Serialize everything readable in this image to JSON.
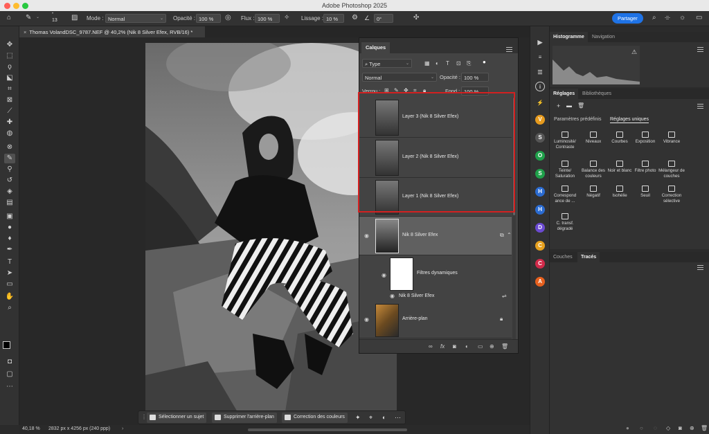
{
  "app": {
    "title": "Adobe Photoshop 2025"
  },
  "options_bar": {
    "brush_size": "13",
    "mode_label": "Mode :",
    "mode_value": "Normal",
    "opacity_label": "Opacité :",
    "opacity_value": "100 %",
    "flow_label": "Flux :",
    "flow_value": "100 %",
    "smoothing_label": "Lissage :",
    "smoothing_value": "10 %",
    "angle_value": "0°",
    "share_label": "Partager"
  },
  "document": {
    "tab_title": "Thomas VolandDSC_9787.NEF @ 40,2% (Nik 8 Silver Efex, RVB/16) *"
  },
  "layers_panel": {
    "tab_label": "Calques",
    "filter_type": "Type",
    "blend_mode": "Normal",
    "opacity_label": "Opacité :",
    "opacity_value": "100 %",
    "lock_label": "Verrou :",
    "fill_label": "Fond :",
    "fill_value": "100 %",
    "layers": [
      {
        "name": "Layer 3 (Nik 8 Silver Efex)",
        "visible": false
      },
      {
        "name": "Layer 2 (Nik 8 Silver Efex)",
        "visible": false
      },
      {
        "name": "Layer 1 (Nik 8 Silver Efex)",
        "visible": false
      },
      {
        "name": "Nik 8 Silver Efex",
        "visible": true,
        "selected": true
      },
      {
        "name": "Filtres dynamiques",
        "visible": true
      },
      {
        "name": "Nik 8 Silver Efex",
        "visible": true
      },
      {
        "name": "Arrière-plan",
        "visible": true,
        "locked": true
      }
    ]
  },
  "context_bar": {
    "select_subject": "Sélectionner un sujet",
    "remove_background": "Supprimer l'arrière-plan",
    "color_correction": "Correction des couleurs"
  },
  "status_bar": {
    "zoom": "40,18 %",
    "dimensions": "2832 px x 4256 px (240 ppp)"
  },
  "histogram_panel": {
    "tabs": [
      "Histogramme",
      "Navigation"
    ]
  },
  "adjustments_panel": {
    "tabs": [
      "Réglages",
      "Bibliothèques"
    ],
    "subtabs": [
      "Paramètres prédéfinis",
      "Réglages uniques"
    ],
    "items": [
      "Luminosité/ Contraste",
      "Niveaux",
      "Courbes",
      "Exposition",
      "Vibrance",
      "Teinte/ Saturation",
      "Balance des couleurs",
      "Noir et blanc",
      "Filtre photo",
      "Mélangeur de couches",
      "Correspond ance de ...",
      "Négatif",
      "Isohélie",
      "Seuil",
      "Correction sélective",
      "C. transf. dégradé"
    ]
  },
  "channels_panel": {
    "tabs": [
      "Couches",
      "Tracés"
    ]
  },
  "icon_strip": [
    "V",
    "S",
    "O",
    "S",
    "H",
    "H",
    "D",
    "C",
    "C",
    "A"
  ],
  "colors": {
    "accent": "#1f73e6",
    "highlight": "#d42020"
  }
}
